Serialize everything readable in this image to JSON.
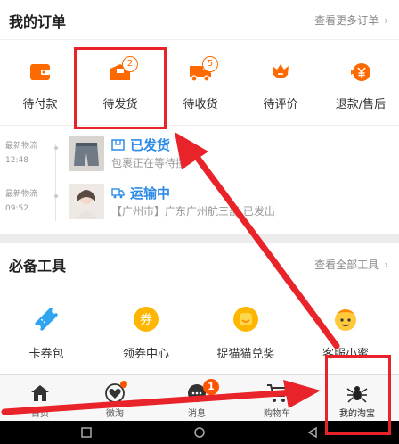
{
  "orders": {
    "title": "我的订单",
    "more_label": "查看更多订单",
    "chevron": "›",
    "items": [
      {
        "label": "待付款",
        "icon": "wallet-icon"
      },
      {
        "label": "待发货",
        "icon": "package-box-icon",
        "badge": "2"
      },
      {
        "label": "待收货",
        "icon": "delivery-truck-icon",
        "badge": "5"
      },
      {
        "label": "待评价",
        "icon": "review-flower-icon"
      },
      {
        "label": "退款/售后",
        "icon": "refund-yen-icon"
      }
    ]
  },
  "logistics": [
    {
      "label": "最新物流",
      "time": "12:48",
      "status": "已发货",
      "desc": "包裹正在等待揽"
    },
    {
      "label": "最新物流",
      "time": "09:52",
      "status": "运输中",
      "desc": "【广州市】广东广州航三部 已发出"
    }
  ],
  "tools": {
    "title": "必备工具",
    "more_label": "查看全部工具",
    "chevron": "›",
    "items": [
      {
        "label": "卡券包",
        "icon": "ticket-icon"
      },
      {
        "label": "领券中心",
        "icon": "coupon-center-icon",
        "icon_text": "券"
      },
      {
        "label": "捉猫猫兑奖",
        "icon": "cat-prize-icon"
      },
      {
        "label": "客服小蜜",
        "icon": "customer-service-icon"
      }
    ]
  },
  "tabbar": [
    {
      "label": "首页",
      "icon": "home-icon"
    },
    {
      "label": "微淘",
      "icon": "heart-icon",
      "dot": true
    },
    {
      "label": "消息",
      "icon": "message-icon",
      "badge": "1"
    },
    {
      "label": "购物车",
      "icon": "cart-icon"
    },
    {
      "label": "我的淘宝",
      "icon": "spider-avatar-icon"
    }
  ],
  "colors": {
    "accent_orange": "#ff6a00",
    "logistics_blue": "#2f8be6",
    "annotation_red": "#e8232a"
  }
}
